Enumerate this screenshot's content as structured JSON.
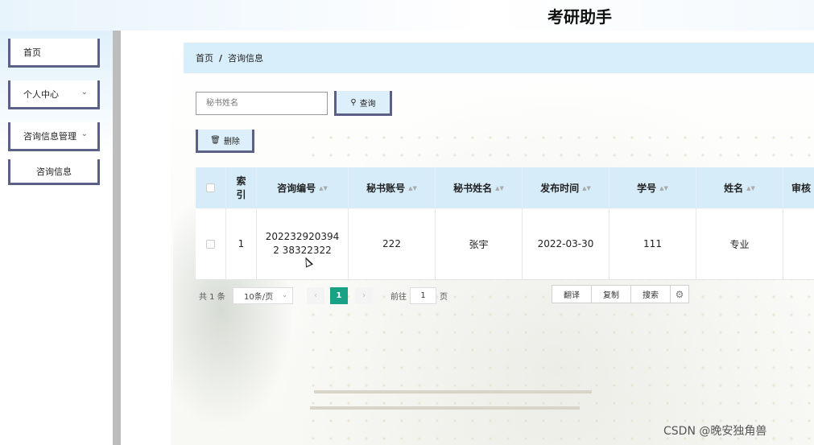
{
  "header": {
    "title": "考研助手"
  },
  "sidebar": {
    "items": [
      {
        "label": "首页"
      },
      {
        "label": "个人中心"
      },
      {
        "label": "咨询信息管理"
      },
      {
        "label": "咨询信息"
      }
    ]
  },
  "breadcrumb": {
    "home": "首页",
    "separator": "/",
    "current": "咨询信息"
  },
  "search": {
    "placeholder": "秘书姓名",
    "query_label": "查询"
  },
  "toolbar": {
    "delete_label": "删除"
  },
  "table": {
    "columns": [
      "索引",
      "咨询编号",
      "秘书账号",
      "秘书姓名",
      "发布时间",
      "学号",
      "姓名",
      "审核"
    ],
    "rows": [
      {
        "index": "1",
        "id": "2022329203942 38322322",
        "secretary_account": "222",
        "secretary_name": "张宇",
        "publish_time": "2022-03-30",
        "student_no": "111",
        "name": "专业",
        "audit": ""
      }
    ]
  },
  "pagination": {
    "total": "共 1 条",
    "page_size": "10条/页",
    "current_page": "1",
    "goto_prefix": "前往",
    "goto_value": "1",
    "goto_suffix": "页"
  },
  "overlay_tools": {
    "translate": "翻译",
    "copy": "复制",
    "search": "搜索"
  },
  "watermark": "CSDN @晚安独角兽",
  "colors": {
    "accent": "#19a186",
    "header_bg": "#d6edf9",
    "button_border": "#5c5f86"
  }
}
